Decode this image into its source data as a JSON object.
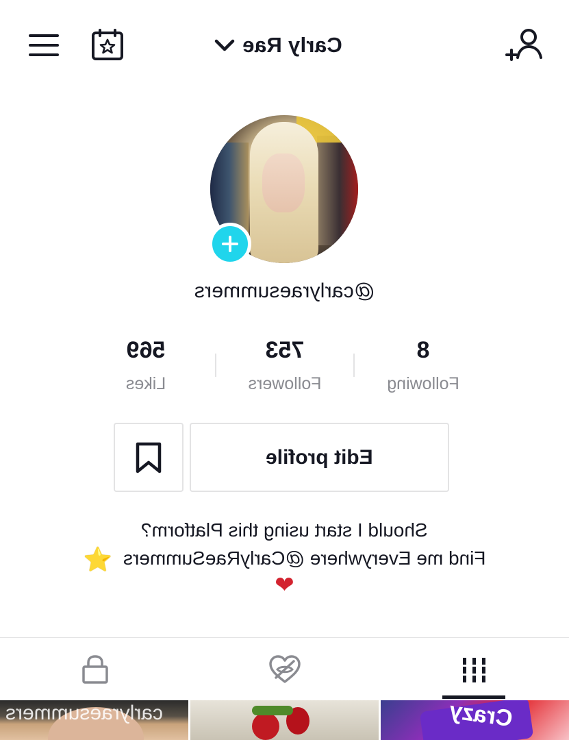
{
  "header": {
    "account_name": "Carly Rae",
    "icons": {
      "menu": "hamburger-menu-icon",
      "calendar": "calendar-star-icon",
      "switch": "chevron-down-icon",
      "add_user": "add-user-icon"
    }
  },
  "profile": {
    "handle": "@carlyraesummers",
    "avatar_add_icon": "plus-icon",
    "accent_color": "#20d5ec"
  },
  "stats": {
    "following": {
      "value": "8",
      "label": "Following"
    },
    "followers": {
      "value": "753",
      "label": "Followers"
    },
    "likes": {
      "value": "569",
      "label": "Likes"
    }
  },
  "actions": {
    "edit_profile_label": "Edit profile",
    "bookmark_icon": "bookmark-icon"
  },
  "bio": {
    "line1": "Should I start using this Platform?",
    "line2": "Find me Everywhere @CarlyRaeSummers",
    "star_emoji": "⭐",
    "heart_emoji": "❤"
  },
  "tabs": {
    "active": "videos",
    "items": [
      {
        "id": "private",
        "icon": "lock-icon"
      },
      {
        "id": "liked",
        "icon": "hidden-heart-icon"
      },
      {
        "id": "videos",
        "icon": "grid-icon"
      }
    ]
  },
  "videos": {
    "watermark": "carlyraesummers",
    "thumb3_text": "Crazy"
  }
}
